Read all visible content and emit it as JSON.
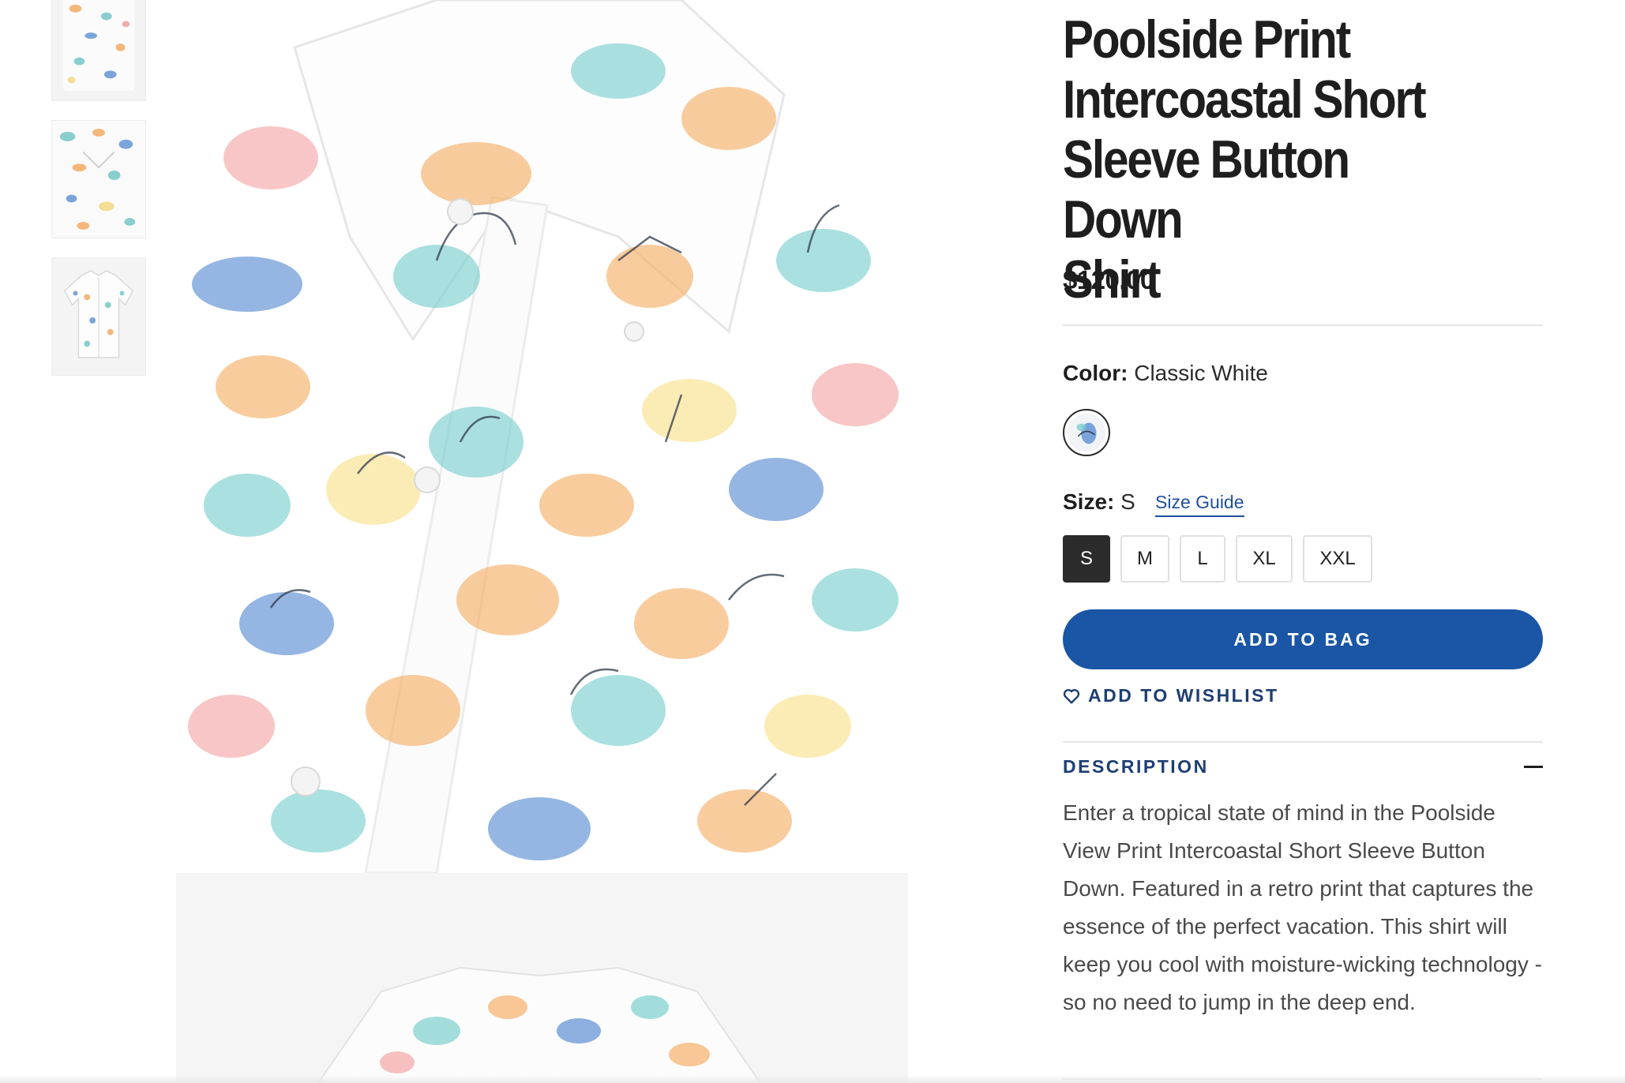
{
  "product": {
    "title": "Poolside Print\nIntercoastal Short\nSleeve Button Down\nShirt",
    "price": "$120.00"
  },
  "color": {
    "label": "Color:",
    "value": "Classic White"
  },
  "size": {
    "label": "Size:",
    "value": "S",
    "guide_label": "Size Guide",
    "options": [
      "S",
      "M",
      "L",
      "XL",
      "XXL"
    ],
    "selected": "S"
  },
  "actions": {
    "add_to_bag": "ADD TO BAG",
    "add_to_wishlist": "ADD TO WISHLIST"
  },
  "description": {
    "heading": "DESCRIPTION",
    "body": "Enter a tropical state of mind in the Poolside View Print Intercoastal Short Sleeve Button Down. Featured in a retro print that captures the essence of the perfect vacation. This shirt will keep you cool with moisture-wicking technology - so no need to jump in the deep end."
  },
  "colors": {
    "accent": "#1a56a5",
    "heading_blue": "#1d3e72",
    "selected_size_bg": "#2b2b2b"
  },
  "icons": {
    "wishlist": "heart-outline-icon",
    "collapse": "minus-icon"
  }
}
